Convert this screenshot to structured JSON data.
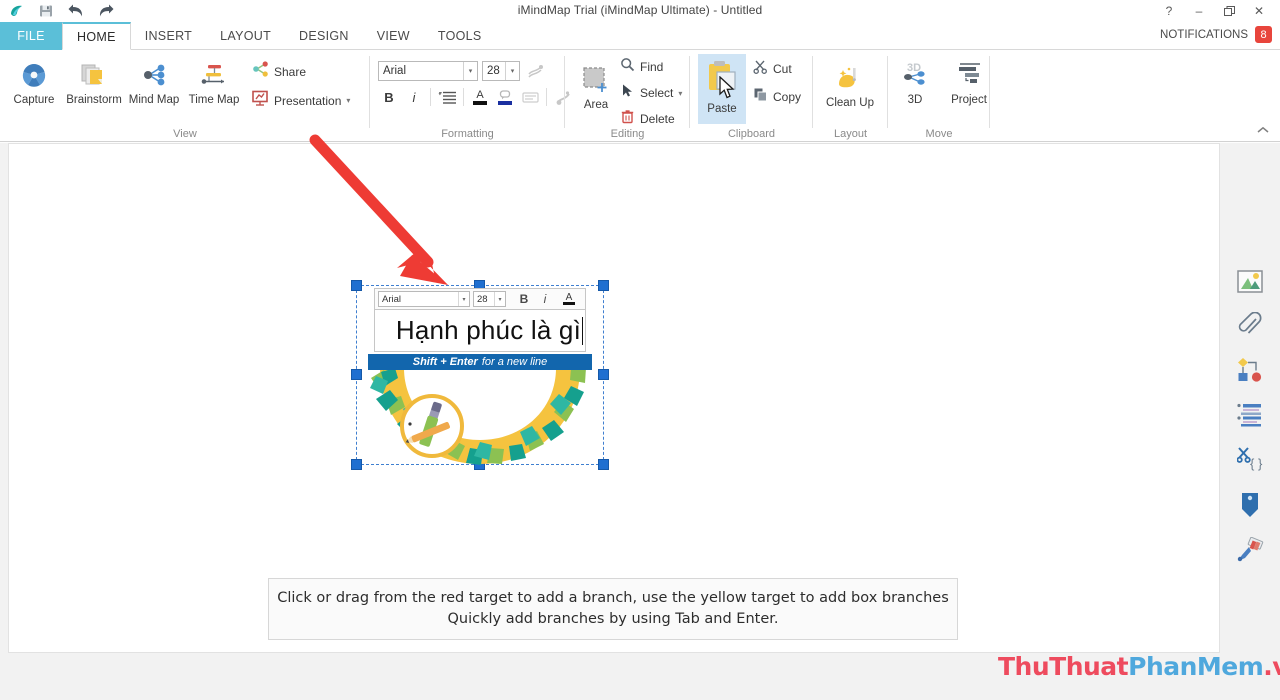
{
  "window": {
    "title": "iMindMap Trial (iMindMap Ultimate) - Untitled",
    "quick_access": [
      {
        "name": "app-logo",
        "icon": "imindmap-logo"
      },
      {
        "name": "save",
        "icon": "floppy-disk-icon"
      },
      {
        "name": "undo",
        "icon": "undo-arrow-icon"
      },
      {
        "name": "redo",
        "icon": "redo-arrow-icon"
      }
    ],
    "controls": [
      {
        "name": "help",
        "glyph": "?"
      },
      {
        "name": "minimize",
        "glyph": "–"
      },
      {
        "name": "restore",
        "glyph": "❐"
      },
      {
        "name": "close",
        "glyph": "✕"
      }
    ]
  },
  "tabs": {
    "file_label": "FILE",
    "items": [
      {
        "label": "HOME",
        "active": true
      },
      {
        "label": "INSERT",
        "active": false
      },
      {
        "label": "LAYOUT",
        "active": false
      },
      {
        "label": "DESIGN",
        "active": false
      },
      {
        "label": "VIEW",
        "active": false
      },
      {
        "label": "TOOLS",
        "active": false
      }
    ],
    "notifications_label": "NOTIFICATIONS",
    "notifications_count": "8",
    "notifications_color": "#e8453c"
  },
  "ribbon": {
    "collapse_glyph": "▲",
    "view": {
      "group_label": "View",
      "buttons": [
        {
          "label": "Capture",
          "icon": "aperture-icon"
        },
        {
          "label": "Brainstorm",
          "icon": "stacked-cards-icon"
        },
        {
          "label": "Mind Map",
          "icon": "mindmap-nodes-icon"
        },
        {
          "label": "Time Map",
          "icon": "timeline-icon"
        }
      ],
      "share_label": "Share",
      "share_icon": "share-nodes-icon",
      "presentation_label": "Presentation",
      "presentation_icon": "presentation-board-icon",
      "presentation_arrow": "▾"
    },
    "formatting": {
      "group_label": "Formatting",
      "font_family": "Arial",
      "font_size": "28",
      "bold_label": "B",
      "italic_label": "i",
      "align_icon": "align-lines-icon",
      "font_color_label": "A",
      "font_color": "#111111",
      "fill_color_icon": "fill-color-icon",
      "fill_color": "#1a2fa0",
      "highlight_icon": "highlight-icon",
      "style_icon": "brush-style-icon",
      "text_effect_icon": "text-effect-icon",
      "dropdown_arrow": "▾"
    },
    "editing": {
      "group_label": "Editing",
      "area_label": "Area",
      "area_icon": "select-area-icon",
      "items": [
        {
          "label": "Find",
          "icon": "magnifier-icon",
          "arrow": ""
        },
        {
          "label": "Select",
          "icon": "cursor-arrow-icon",
          "arrow": "▾"
        },
        {
          "label": "Delete",
          "icon": "trash-icon",
          "arrow": ""
        }
      ]
    },
    "clipboard": {
      "group_label": "Clipboard",
      "paste_label": "Paste",
      "paste_icon": "clipboard-icon",
      "paste_hover": true,
      "items": [
        {
          "label": "Cut",
          "icon": "scissors-icon"
        },
        {
          "label": "Copy",
          "icon": "copy-icon"
        }
      ]
    },
    "layout": {
      "group_label": "Layout",
      "clean_up_label": "Clean Up",
      "clean_up_icon": "sparkle-broom-icon"
    },
    "move": {
      "group_label": "Move",
      "buttons": [
        {
          "label": "3D",
          "icon": "3d-nodes-icon"
        },
        {
          "label": "Project",
          "icon": "project-bars-icon"
        }
      ]
    }
  },
  "node_editor": {
    "font_family": "Arial",
    "font_size": "28",
    "bold_label": "B",
    "italic_label": "i",
    "font_color_label": "A",
    "dropdown_arrow": "▾",
    "text_value": "Hạnh phúc là gì",
    "hint_bold": "Shift + Enter",
    "hint_rest": "for a new line",
    "hint_bg": "#1266ad",
    "selection_handle_color": "#1f6fd0"
  },
  "right_dock": {
    "icons": [
      {
        "name": "image-icon",
        "label": "Image"
      },
      {
        "name": "paperclip-icon",
        "label": "Attachment"
      },
      {
        "name": "flowchart-icon",
        "label": "Shapes"
      },
      {
        "name": "notes-list-icon",
        "label": "Notes"
      },
      {
        "name": "code-snippet-icon",
        "label": "Snippet"
      },
      {
        "name": "tag-icon",
        "label": "Tag"
      },
      {
        "name": "paintbrush-icon",
        "label": "Brush"
      }
    ]
  },
  "instruction": {
    "line1": "Click or drag from the red target to add a branch, use the yellow target to add box branches",
    "line2": "Quickly add branches by using Tab and Enter."
  },
  "annotation": {
    "arrow_color": "#ee3b34",
    "name": "red-pointer-arrow"
  },
  "watermark": {
    "part1": "ThuThuat",
    "part2": "PhanMem",
    "part3": ".vn",
    "color1": "#ee4b5e",
    "color2": "#4fa8dd"
  }
}
